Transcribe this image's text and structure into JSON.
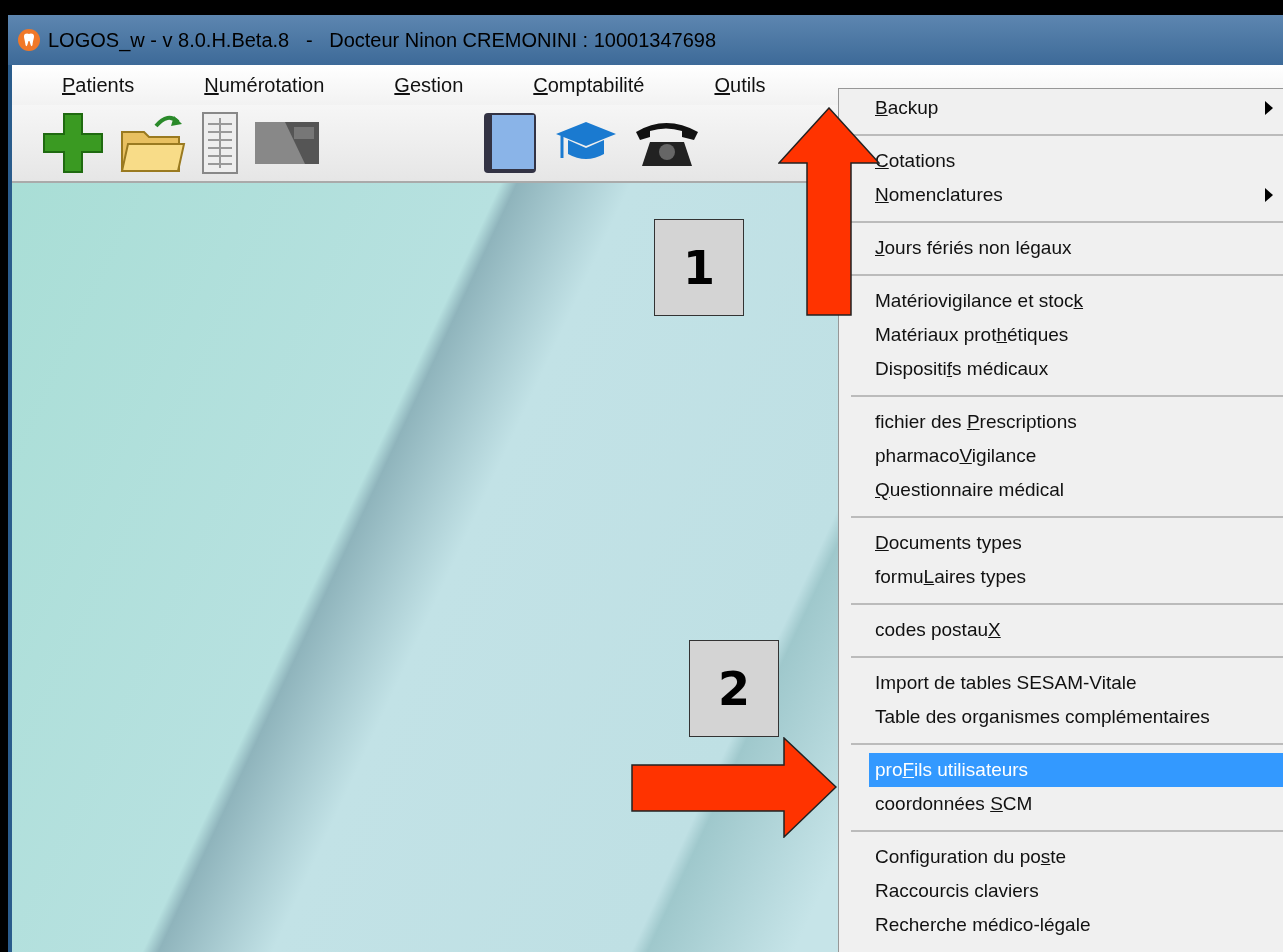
{
  "window": {
    "title": "LOGOS_w - v 8.0.H.Beta.8   -   Docteur Ninon CREMONINI : 10001347698"
  },
  "menu_bar": [
    {
      "key": "P",
      "post": "atients"
    },
    {
      "key": "N",
      "post": "umérotation"
    },
    {
      "key": "G",
      "post": "estion"
    },
    {
      "key": "C",
      "post": "omptabilité"
    },
    {
      "key": "O",
      "post": "utils"
    }
  ],
  "toolbar": [
    {
      "kind": "plus"
    },
    {
      "kind": "folder"
    },
    {
      "kind": "sheet"
    },
    {
      "kind": "card"
    },
    {
      "kind": "gap"
    },
    {
      "kind": "book"
    },
    {
      "kind": "cap"
    },
    {
      "kind": "phone"
    }
  ],
  "dropdown": [
    {
      "kind": "item",
      "key": "B",
      "post": "ackup",
      "submenu": true,
      "selected": false
    },
    {
      "kind": "separator"
    },
    {
      "kind": "item",
      "key": "C",
      "post": "otations",
      "submenu": false,
      "selected": false
    },
    {
      "kind": "item",
      "key": "N",
      "post": "omenclatures",
      "submenu": true,
      "selected": false
    },
    {
      "kind": "separator"
    },
    {
      "kind": "item",
      "key": "J",
      "post": "ours fériés non légaux",
      "submenu": false,
      "selected": false
    },
    {
      "kind": "separator"
    },
    {
      "kind": "item",
      "pre": "Matériovigilance et stoc",
      "key": "k",
      "submenu": false,
      "selected": false
    },
    {
      "kind": "item",
      "pre": "Matériaux prot",
      "key": "h",
      "post": "étiques",
      "submenu": false,
      "selected": false
    },
    {
      "kind": "item",
      "pre": "Dispositi",
      "key": "f",
      "post": "s médicaux",
      "submenu": false,
      "selected": false
    },
    {
      "kind": "separator"
    },
    {
      "kind": "item",
      "pre": "fichier des ",
      "key": "P",
      "post": "rescriptions",
      "submenu": false,
      "selected": false
    },
    {
      "kind": "item",
      "pre": "pharmaco",
      "key": "V",
      "post": "igilance",
      "submenu": false,
      "selected": false
    },
    {
      "kind": "item",
      "key": "Q",
      "post": "uestionnaire médical",
      "submenu": false,
      "selected": false
    },
    {
      "kind": "separator"
    },
    {
      "kind": "item",
      "key": "D",
      "post": "ocuments types",
      "submenu": false,
      "selected": false
    },
    {
      "kind": "item",
      "pre": "formu",
      "key": "L",
      "post": "aires types",
      "submenu": false,
      "selected": false
    },
    {
      "kind": "separator"
    },
    {
      "kind": "item",
      "pre": "codes postau",
      "key": "X",
      "submenu": false,
      "selected": false
    },
    {
      "kind": "separator"
    },
    {
      "kind": "item",
      "pre": "Import de tables SESAM-Vitale",
      "submenu": false,
      "selected": false
    },
    {
      "kind": "item",
      "pre": "Table des organismes complémentaires",
      "submenu": false,
      "selected": false
    },
    {
      "kind": "separator"
    },
    {
      "kind": "item",
      "pre": "pro",
      "key": "F",
      "post": "ils utilisateurs",
      "submenu": false,
      "selected": true
    },
    {
      "kind": "item",
      "pre": "coordonnées ",
      "key": "S",
      "post": "CM",
      "submenu": false,
      "selected": false
    },
    {
      "kind": "separator"
    },
    {
      "kind": "item",
      "pre": "Configuration du po",
      "key": "s",
      "post": "te",
      "submenu": false,
      "selected": false
    },
    {
      "kind": "item",
      "pre": "Raccourcis claviers",
      "submenu": false,
      "selected": false
    },
    {
      "kind": "item",
      "pre": "Recherche médico-légale",
      "submenu": false,
      "selected": false
    }
  ],
  "annotations": [
    {
      "kind": "number",
      "text": "1"
    },
    {
      "kind": "arrow_up"
    },
    {
      "kind": "number",
      "text": "2"
    },
    {
      "kind": "arrow_right"
    }
  ]
}
